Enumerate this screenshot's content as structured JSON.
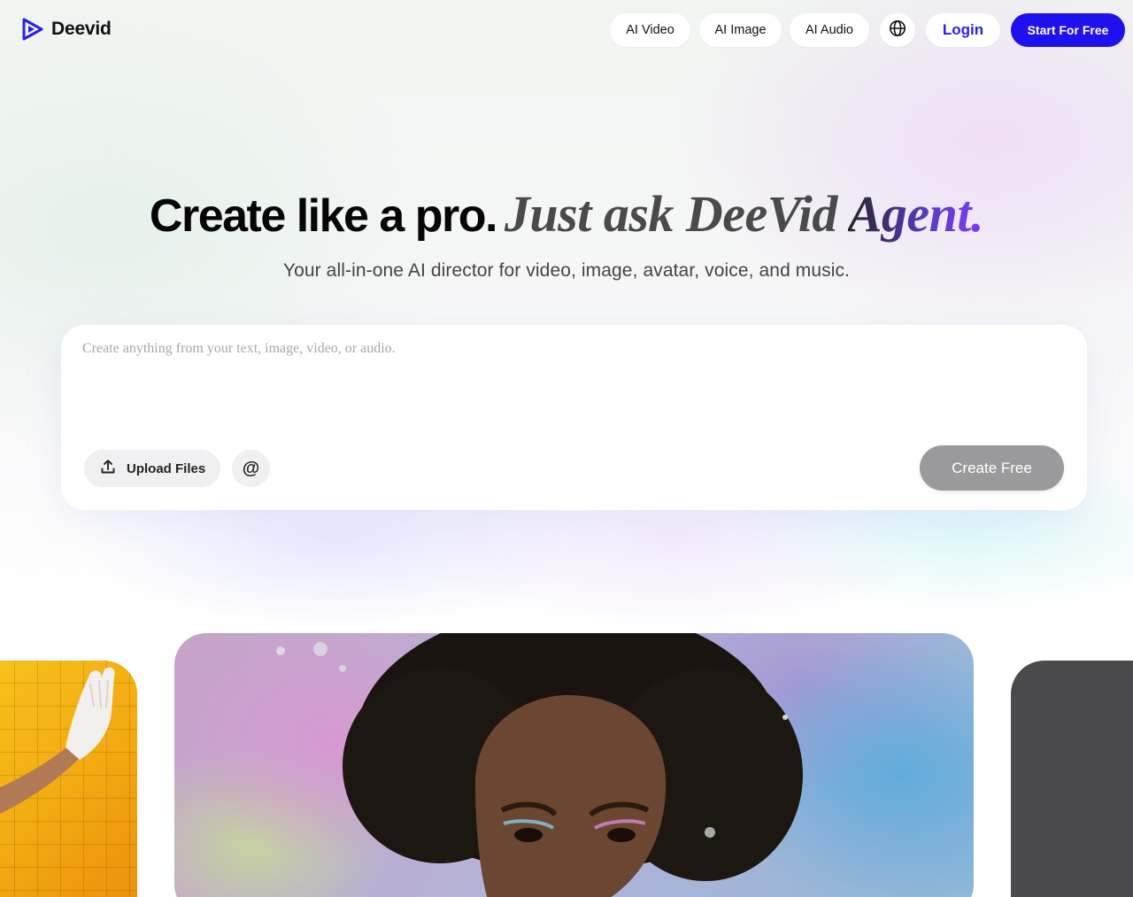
{
  "brand": {
    "name": "Deevid",
    "logo_icon": "play-logo-icon",
    "accent": "#2a1fe8"
  },
  "nav": {
    "links": [
      "AI Video",
      "AI Image",
      "AI Audio"
    ],
    "language_icon": "globe-icon",
    "login_label": "Login",
    "start_label": "Start For Free"
  },
  "hero": {
    "title_bold": "Create like a pro.",
    "title_italic_a": "Just ask DeeVid",
    "title_italic_b": "Agent.",
    "subtitle": "Your all-in-one AI director for video, image, avatar, voice, and music."
  },
  "prompt": {
    "placeholder": "Create anything from your text, image, video, or audio.",
    "value": "",
    "upload_label": "Upload Files",
    "upload_icon": "upload-icon",
    "mention_symbol": "@",
    "create_label": "Create Free"
  },
  "gallery": {
    "items": [
      {
        "alt": "gloved-hand-yellow-tiles"
      },
      {
        "alt": "woman-portrait-underwater"
      },
      {
        "alt": "dark-tile"
      }
    ]
  },
  "colors": {
    "primary_button": "#1f10ee",
    "create_button_disabled": "#9a9a9c"
  }
}
